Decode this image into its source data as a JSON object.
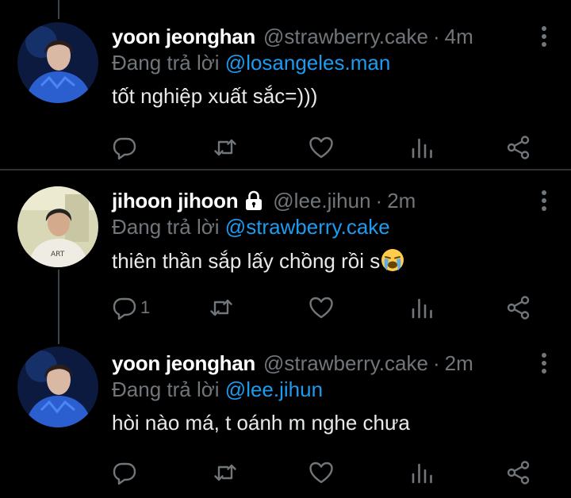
{
  "tweets": [
    {
      "name": "yoon jeonghan",
      "handle": "@strawberry.cake",
      "dot": "·",
      "time": "4m",
      "reply_prefix": "Đang trả lời",
      "reply_to": "@losangeles.man",
      "text": "tốt nghiệp xuất sắc=)))",
      "reply_count": "",
      "protected": false
    },
    {
      "name": "jihoon jihoon",
      "handle": "@lee.jihun",
      "dot": "·",
      "time": "2m",
      "reply_prefix": "Đang trả lời",
      "reply_to": "@strawberry.cake",
      "text": "thiên thần sắp lấy chồng rồi s",
      "reply_count": "1",
      "protected": true,
      "emoji": "loudly-crying-face-emoji"
    },
    {
      "name": "yoon jeonghan",
      "handle": "@strawberry.cake",
      "dot": "·",
      "time": "2m",
      "reply_prefix": "Đang trả lời",
      "reply_to": "@lee.jihun",
      "text": "hòi nào má, t oánh m nghe chưa",
      "reply_count": "",
      "protected": false
    }
  ],
  "icons": [
    "more-vertical-icon",
    "reply-icon",
    "retweet-icon",
    "like-icon",
    "views-icon",
    "share-icon",
    "lock-icon"
  ],
  "colors": {
    "background": "#000000",
    "text": "#e7e9ea",
    "muted": "#71767b",
    "link": "#1d9bf0",
    "divider": "#2f3336",
    "thread_line": "#38444d"
  }
}
